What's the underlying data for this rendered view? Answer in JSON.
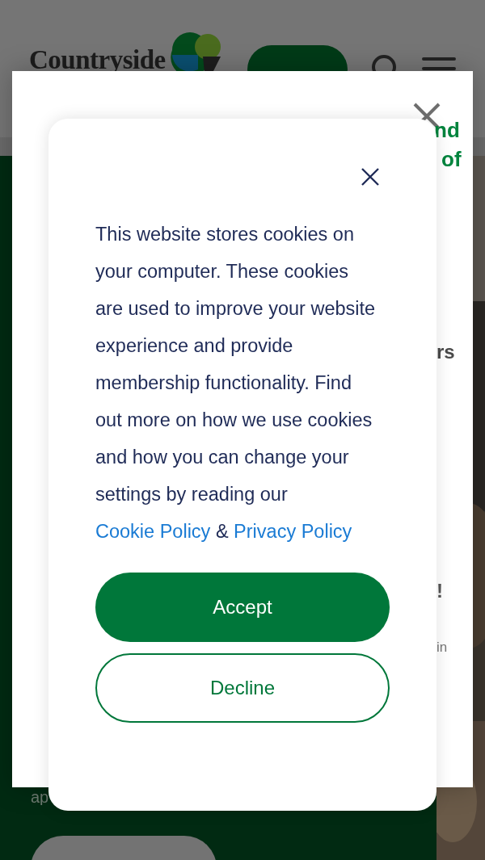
{
  "header": {
    "logo_text": "Countryside"
  },
  "background_fragments": [
    {
      "text": "nd",
      "kind": "heading"
    },
    {
      "text": "of",
      "kind": "heading"
    },
    {
      "text": "rs",
      "kind": "subheading"
    },
    {
      "text": "!",
      "kind": "body"
    },
    {
      "text": "in",
      "kind": "small"
    }
  ],
  "page_text_fragment": "ap",
  "cookie_dialog": {
    "message_parts": [
      {
        "kind": "text",
        "text": "This website stores cookies on your computer. These cookies are used to improve your website experience and provide membership functionality. Find out more on how we use cookies and how you can change your settings by reading our "
      },
      {
        "kind": "link",
        "text": "Cookie Policy"
      },
      {
        "kind": "text",
        "text": " & "
      },
      {
        "kind": "link",
        "text": "Privacy Policy"
      }
    ],
    "buttons": [
      {
        "kind": "primary",
        "label": "Accept"
      },
      {
        "kind": "outline",
        "label": "Decline"
      }
    ]
  }
}
